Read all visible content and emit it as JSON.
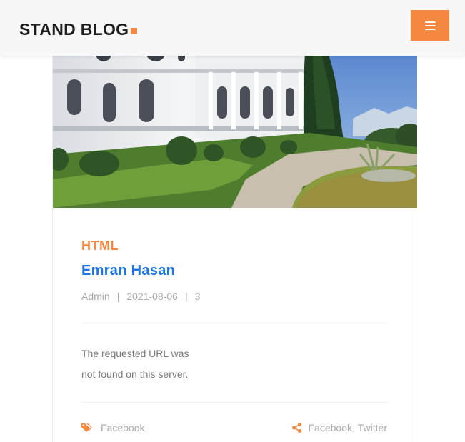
{
  "header": {
    "logo_text": "STAND BLOG",
    "menu_icon": "hamburger-menu-icon",
    "accent_color": "#f48840"
  },
  "post": {
    "image_alt": "building",
    "category": "HTML",
    "title": "Emran Hasan",
    "meta": {
      "author": "Admin",
      "date": "2021-08-06",
      "comments": "3"
    },
    "body_line1": "The requested URL was",
    "body_line2": "not found on this server.",
    "tags": {
      "icon": "tags-icon",
      "items": [
        "Facebook,"
      ]
    },
    "share": {
      "icon": "share-icon",
      "items": [
        "Facebook",
        "Twitter"
      ],
      "separator": ","
    }
  },
  "colors": {
    "accent": "#f48840",
    "title": "#1a73e8",
    "muted": "#aaaaaa",
    "body": "#7a7a7a"
  }
}
